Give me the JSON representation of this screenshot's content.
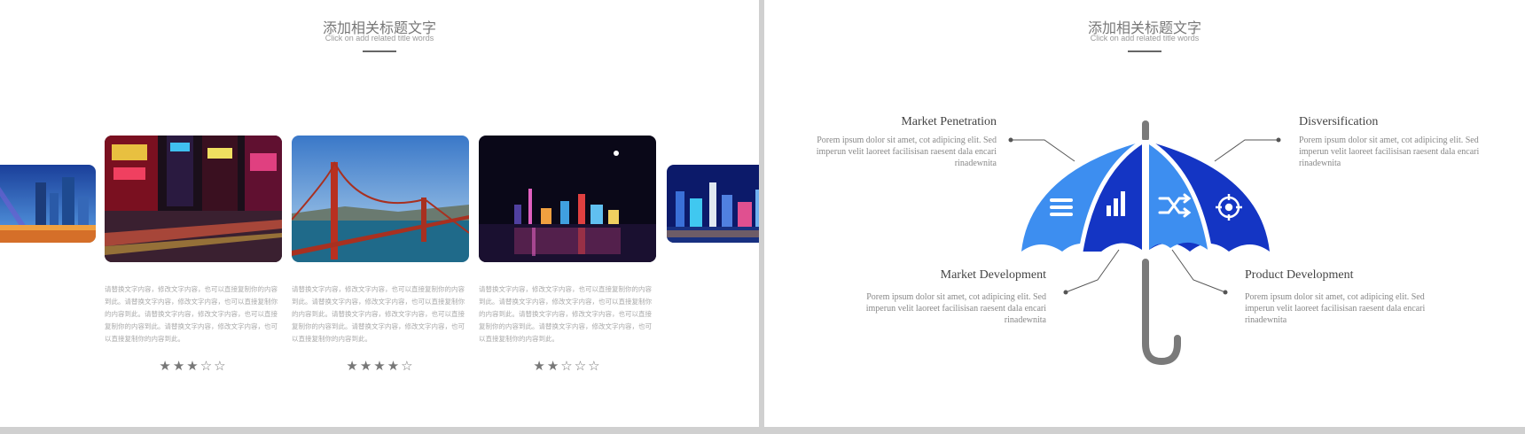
{
  "left_slide": {
    "title_cn": "添加相关标题文字",
    "title_en": "Click on add related title words",
    "cards": [
      {
        "photo_icon": "city-street-night-photo",
        "text": "请替换文字内容，修改文字内容，也可以直接复制你的内容到此。请替换文字内容，修改文字内容，也可以直接复制你的内容到此。请替换文字内容，修改文字内容，也可以直接复制你的内容到此。请替换文字内容，修改文字内容，也可以直接复制你的内容到此。",
        "rating": 3,
        "stars": "★★★☆☆"
      },
      {
        "photo_icon": "bridge-photo",
        "text": "请替换文字内容，修改文字内容，也可以直接复制你的内容到此。请替换文字内容，修改文字内容，也可以直接复制你的内容到此。请替换文字内容，修改文字内容，也可以直接复制你的内容到此。请替换文字内容，修改文字内容，也可以直接复制你的内容到此。",
        "rating": 4,
        "stars": "★★★★☆"
      },
      {
        "photo_icon": "skyline-night-photo",
        "text": "请替换文字内容，修改文字内容，也可以直接复制你的内容到此。请替换文字内容，修改文字内容，也可以直接复制你的内容到此。请替换文字内容，修改文字内容，也可以直接复制你的内容到此。请替换文字内容，修改文字内容，也可以直接复制你的内容到此。",
        "rating": 2,
        "stars": "★★☆☆☆"
      }
    ]
  },
  "right_slide": {
    "title_cn": "添加相关标题文字",
    "title_en": "Click on add related title words",
    "points": {
      "market_penetration": {
        "title": "Market Penetration",
        "body": "Porem ipsum dolor sit amet, cot adipicing elit. Sed imperun velit laoreet facilisisan raesent dala encari rinadewnita"
      },
      "disversification": {
        "title": "Disversification",
        "body": "Porem ipsum dolor sit amet, cot adipicing elit. Sed imperun velit laoreet facilisisan raesent dala encari rinadewnita"
      },
      "market_development": {
        "title": "Market Development",
        "body": "Porem ipsum dolor sit amet, cot adipicing elit. Sed imperun velit laoreet facilisisan raesent dala encari rinadewnita"
      },
      "product_development": {
        "title": "Product Development",
        "body": "Porem ipsum dolor sit amet, cot adipicing elit. Sed imperun velit laoreet facilisisan raesent dala encari rinadewnita"
      }
    },
    "umbrella_icons": [
      "menu-icon",
      "bar-chart-icon",
      "shuffle-icon",
      "crosshair-icon"
    ],
    "colors": {
      "light_blue": "#3d8ef0",
      "dark_blue": "#1435c4",
      "handle_gray": "#7a7a7a"
    }
  }
}
